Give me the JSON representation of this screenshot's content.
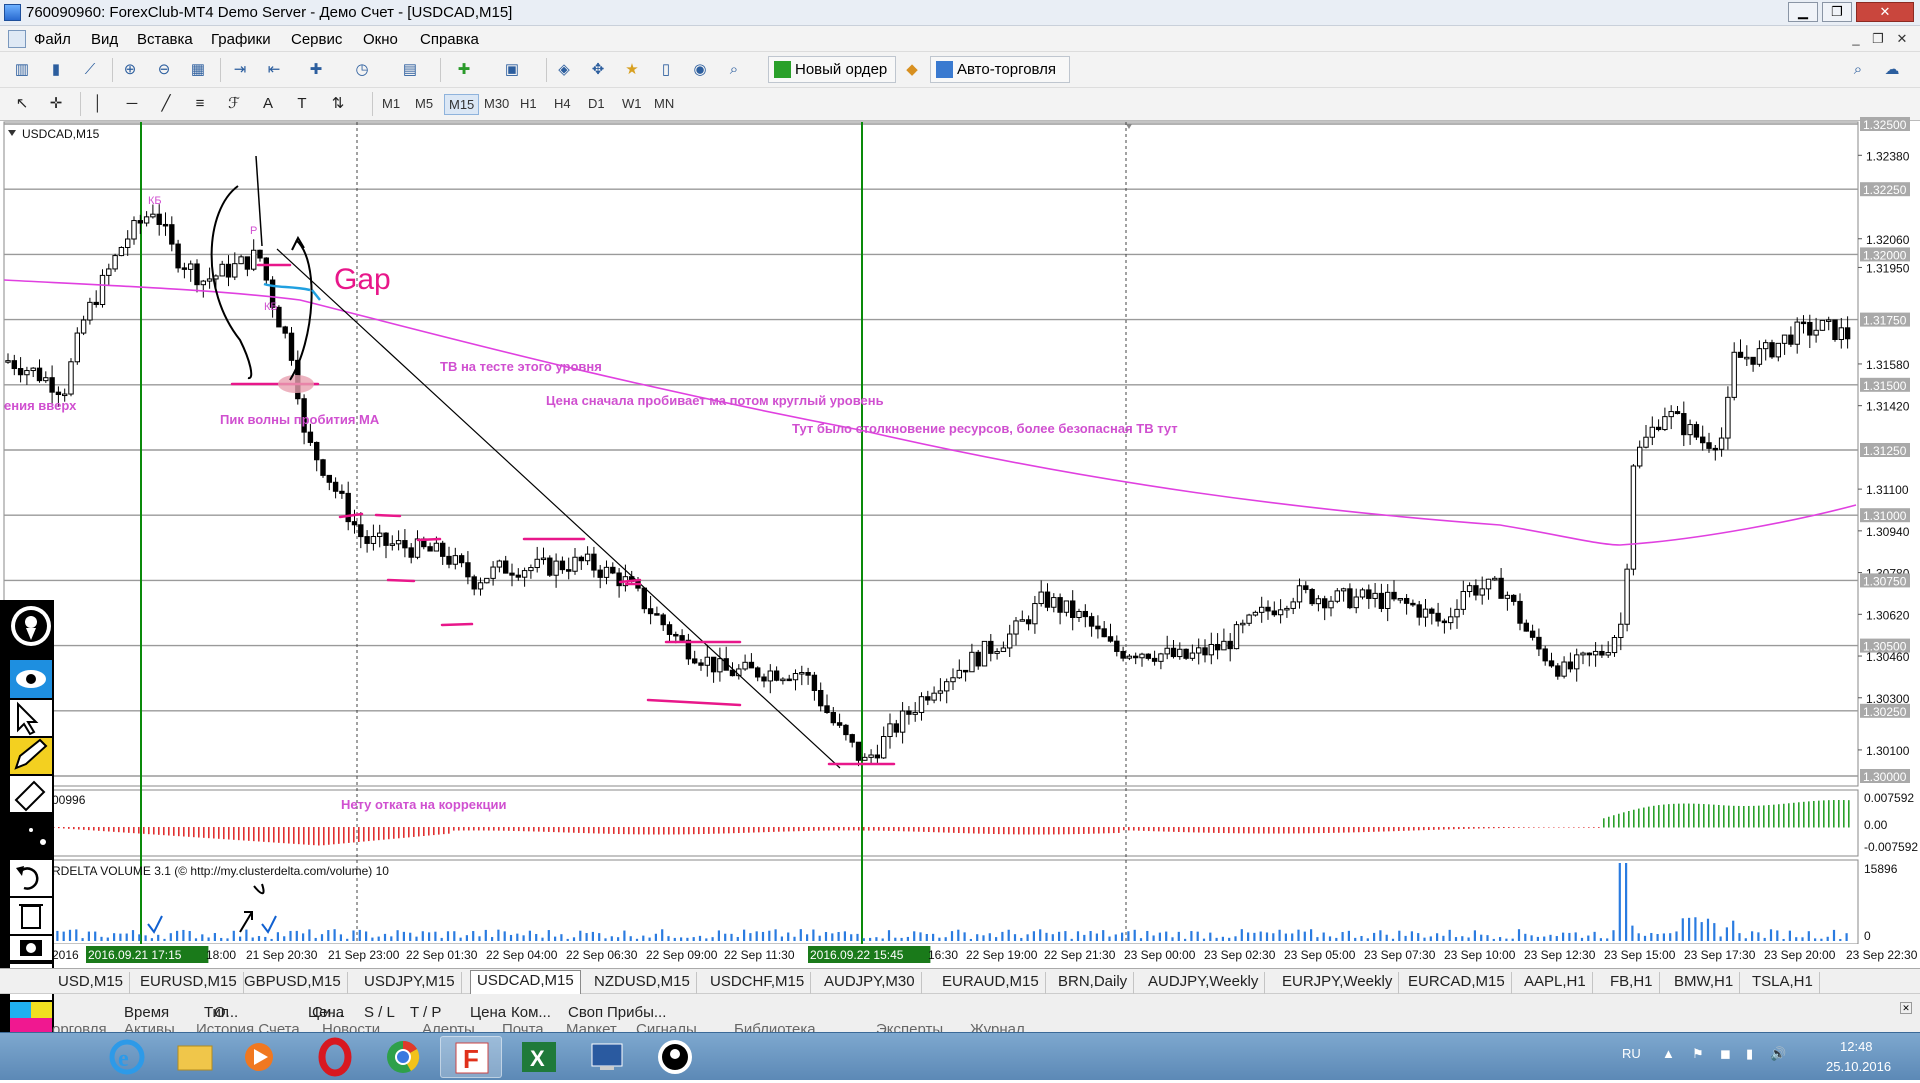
{
  "window": {
    "title": "760090960: ForexClub-MT4 Demo Server - Демо Счет - [USDCAD,M15]",
    "minimize": "▁",
    "maximize": "❐",
    "close": "✕"
  },
  "menu": [
    "Файл",
    "Вид",
    "Вставка",
    "Графики",
    "Сервис",
    "Окно",
    "Справка"
  ],
  "toolbar": {
    "new_order": "Новый ордер",
    "auto_trading": "Авто-торговля"
  },
  "timeframes": [
    "M1",
    "M5",
    "M15",
    "M30",
    "H1",
    "H4",
    "D1",
    "W1",
    "MN"
  ],
  "selected_timeframe": "M15",
  "chart": {
    "symbol_label": "USDCAD,M15",
    "price_axis": [
      "1.32500",
      "1.32380",
      "1.32250",
      "1.32060",
      "1.32000",
      "1.31950",
      "1.31750",
      "1.31580",
      "1.31500",
      "1.31420",
      "1.31250",
      "1.31100",
      "1.31000",
      "1.30940",
      "1.30780",
      "1.30750",
      "1.30620",
      "1.30500",
      "1.30460",
      "1.30300",
      "1.30250",
      "1.30100",
      "1.30000"
    ],
    "boxed_levels": [
      "1.32500",
      "1.32250",
      "1.32000",
      "1.31750",
      "1.31500",
      "1.31250",
      "1.31000",
      "1.30750",
      "1.30500",
      "1.30250",
      "1.30000"
    ],
    "annotations": {
      "gap": "Gap",
      "tv_test": "ТВ на тесте этого уровня",
      "price_breaks": "Цена сначала пробивает ма потом круглый уровень",
      "resource_clash": "Тут было столкновение ресурсов, более безопасная ТВ тут",
      "wave_peak": "Пик волны пробития МА",
      "left_cut": "ения вверх",
      "no_pullback": "Нету отката на коррекции",
      "kb1": "КБ",
      "kb2": "КБ",
      "p": "Р"
    },
    "time_axis": [
      "2016",
      "2016.09.21 17:15",
      "18:00",
      "21 Sep 20:30",
      "21 Sep 23:00",
      "22 Sep 01:30",
      "22 Sep 04:00",
      "22 Sep 06:30",
      "22 Sep 09:00",
      "22 Sep 11:30",
      "2016.09.22 15:45",
      "16:30",
      "22 Sep 19:00",
      "22 Sep 21:30",
      "23 Sep 00:00",
      "23 Sep 02:30",
      "23 Sep 05:00",
      "23 Sep 07:30",
      "23 Sep 10:00",
      "23 Sep 12:30",
      "23 Sep 15:00",
      "23 Sep 17:30",
      "23 Sep 20:00",
      "23 Sep 22:30"
    ],
    "highlighted_times": [
      "2016.09.21 17:15",
      "2016.09.22 15:45"
    ],
    "osc_label": "00996",
    "osc_axis": [
      "0.007592",
      "0.00",
      "-0.007592"
    ],
    "vol_label": "RDELTA VOLUME 3.1 (© http://my.clusterdelta.com/volume) 10",
    "vol_axis": [
      "15896",
      "0"
    ]
  },
  "chart_tabs": [
    "USD,M15",
    "EURUSD,M15",
    "GBPUSD,M15",
    "USDJPY,M15",
    "USDCAD,M15",
    "NZDUSD,M15",
    "USDCHF,M15",
    "AUDJPY,M30",
    "EURAUD,M15",
    "BRN,Daily",
    "AUDJPY,Weekly",
    "EURJPY,Weekly",
    "EURCAD,M15",
    "AAPL,H1",
    "FB,H1",
    "BMW,H1",
    "TSLA,H1"
  ],
  "active_tab": "USDCAD,M15",
  "terminal": {
    "headers": [
      "Время",
      "Тип",
      "О...",
      "Си...",
      "Цена",
      "S / L",
      "T / P",
      "Цена",
      "Ком...",
      "Своп",
      "Прибы..."
    ],
    "bottom_tabs": [
      "орговля",
      "Активы",
      "История Счета",
      "Новости",
      "Алерты",
      "Почта",
      "Маркет",
      "Сигналы",
      "Библиотека",
      "Эксперты",
      "Журнал"
    ]
  },
  "taskbar": {
    "lang": "RU",
    "time": "12:48",
    "date": "25.10.2016"
  },
  "colors": {
    "ma": "#e040e0",
    "pen": "#e8178a",
    "green_line": "#0a8a0a",
    "vol_bar": "#2a7be0",
    "osc_pos": "#2aa02a",
    "osc_neg": "#e03030"
  }
}
